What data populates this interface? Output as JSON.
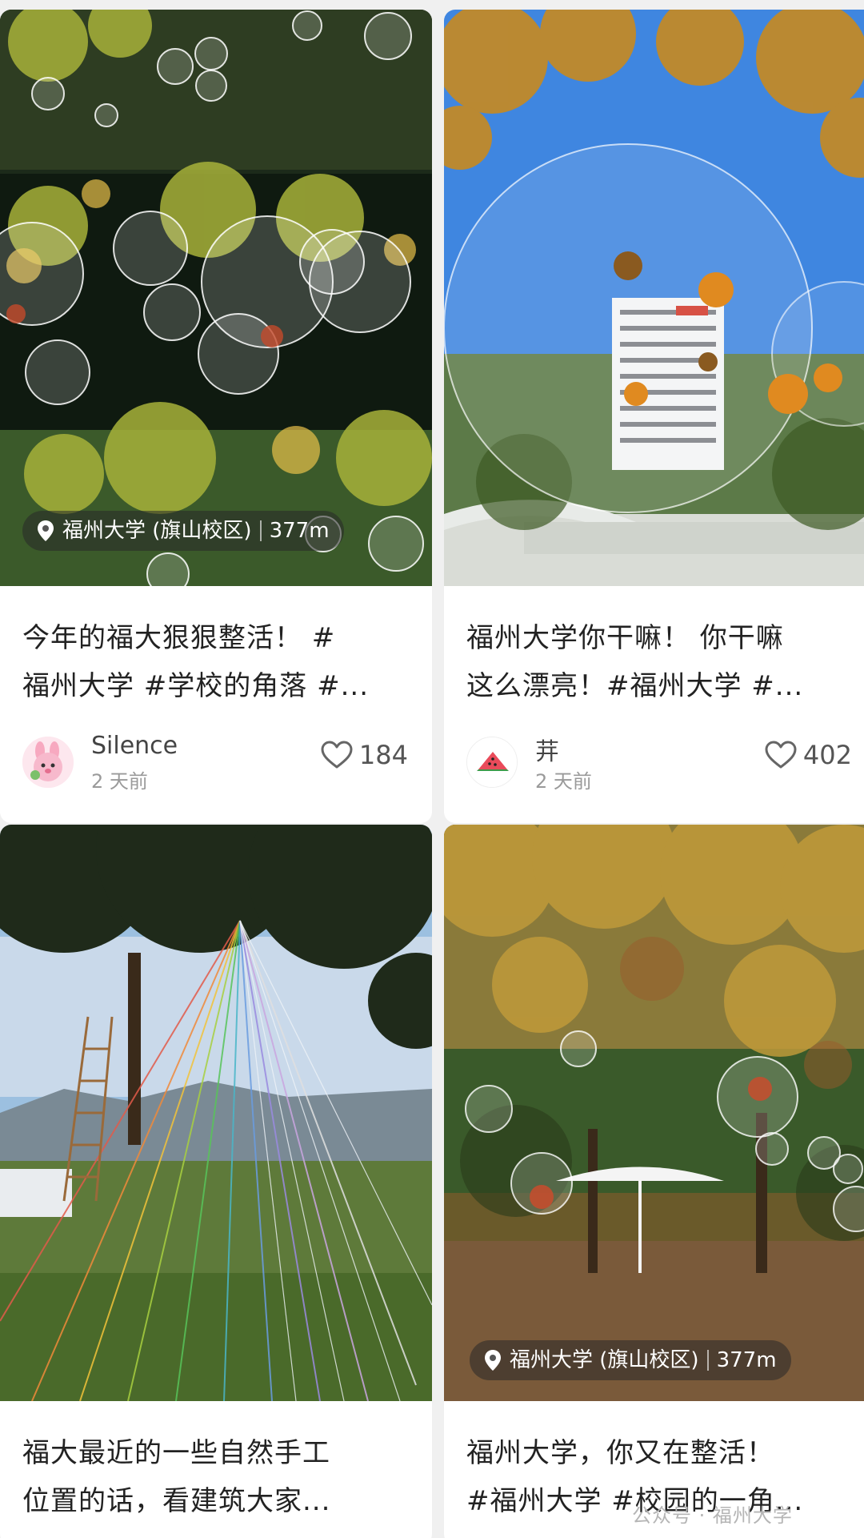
{
  "cards": [
    {
      "location": {
        "place": "福州大学 (旗山校区)",
        "distance": "377m"
      },
      "title": "今年的福大狠狠整活！ #\n福州大学 #学校的角落 #...",
      "author": "Silence",
      "time": "2 天前",
      "likes": "184",
      "avatar_icon": "pink-bunny-avatar"
    },
    {
      "title": "福州大学你干嘛！ 你干嘛\n这么漂亮！#福州大学 #...",
      "author": "茾",
      "time": "2 天前",
      "likes": "402",
      "avatar_icon": "watermelon-avatar"
    },
    {
      "title": "福大最近的一些自然手工\n位置的话，看建筑大家..."
    },
    {
      "location": {
        "place": "福州大学 (旗山校区)",
        "distance": "377m"
      },
      "title": "福州大学，你又在整活！\n#福州大学 #校园的一角..."
    }
  ],
  "watermark": "公众号 · 福州大学"
}
